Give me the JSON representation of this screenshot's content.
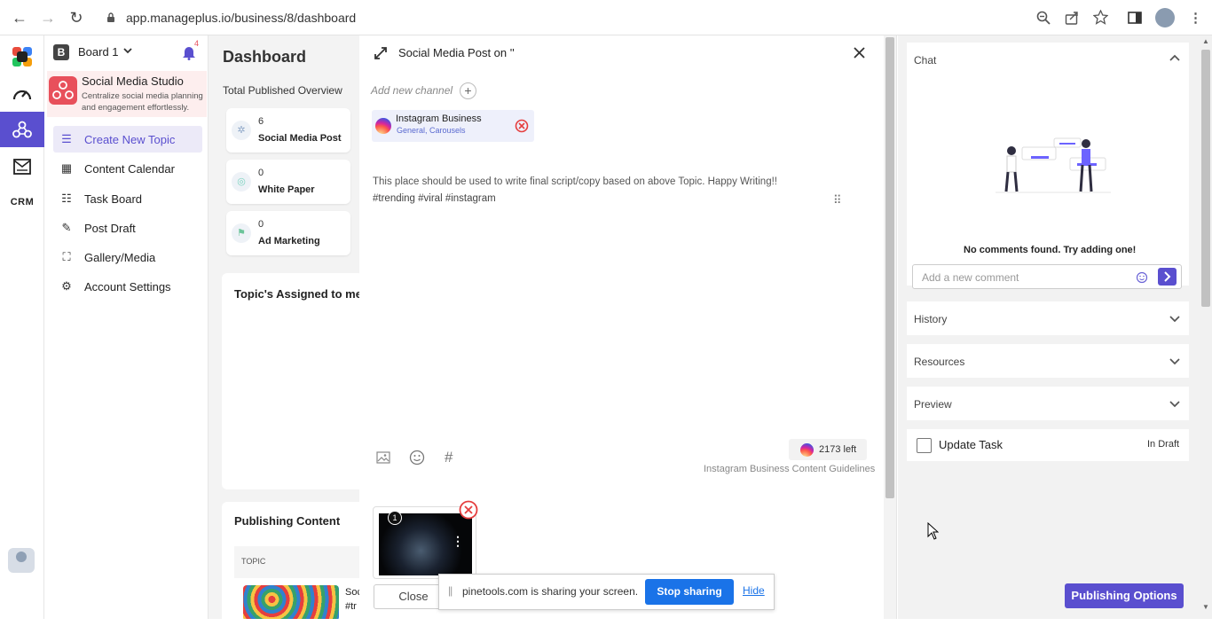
{
  "browser": {
    "url": "app.manageplus.io/business/8/dashboard",
    "back": "←",
    "forward": "→",
    "reload": "↻"
  },
  "board": {
    "letter": "B",
    "name": "Board 1",
    "notif_count": "4"
  },
  "workspace": {
    "title": "Social Media Studio",
    "subtitle": "Centralize social media planning and engagement effortlessly."
  },
  "rail": {
    "crm": "CRM"
  },
  "sidebar": {
    "items": [
      {
        "label": "Create New Topic",
        "icon": "list-plus-icon"
      },
      {
        "label": "Content Calendar",
        "icon": "calendar-icon"
      },
      {
        "label": "Task Board",
        "icon": "task-list-icon"
      },
      {
        "label": "Post Draft",
        "icon": "draft-icon"
      },
      {
        "label": "Gallery/Media",
        "icon": "gallery-icon"
      },
      {
        "label": "Account Settings",
        "icon": "account-settings-icon"
      }
    ]
  },
  "dashboard": {
    "title": "Dashboard",
    "overview_title": "Total Published Overview",
    "cards": [
      {
        "count": "6",
        "label": "Social Media Post"
      },
      {
        "count": "0",
        "label": "White Paper"
      },
      {
        "count": "0",
        "label": "Ad Marketing"
      }
    ],
    "assigned_title": "Topic's Assigned to me",
    "publishing_title": "Publishing Content",
    "table_header": "TOPIC",
    "row_text_1": "Soc",
    "row_text_2": "#tr"
  },
  "modal": {
    "title": "Social Media Post on ''",
    "add_channel": "Add new channel",
    "channel": {
      "name": "Instagram Business",
      "sub": "General, Carousels"
    },
    "body_line1": "This place should be used to write final script/copy based on above Topic. Happy Writing!!",
    "body_line2": "#trending #viral #instagram",
    "chars_left": "2173 left",
    "guidelines": "Instagram Business Content Guidelines",
    "media_index": "1",
    "close_label": "Close",
    "publishing_options": "Publishing Options"
  },
  "share_bar": {
    "text": "pinetools.com is sharing your screen.",
    "stop": "Stop sharing",
    "hide": "Hide"
  },
  "right_panel": {
    "chat_title": "Chat",
    "empty_text": "No comments found. Try adding one!",
    "comment_placeholder": "Add a new comment",
    "history": "History",
    "resources": "Resources",
    "preview": "Preview",
    "update_task": "Update Task",
    "status": "In Draft"
  },
  "colors": {
    "accent": "#5a4fcf",
    "brand_red": "#e8505b",
    "instagram": "#d6249f",
    "share_blue": "#1a73e8"
  }
}
